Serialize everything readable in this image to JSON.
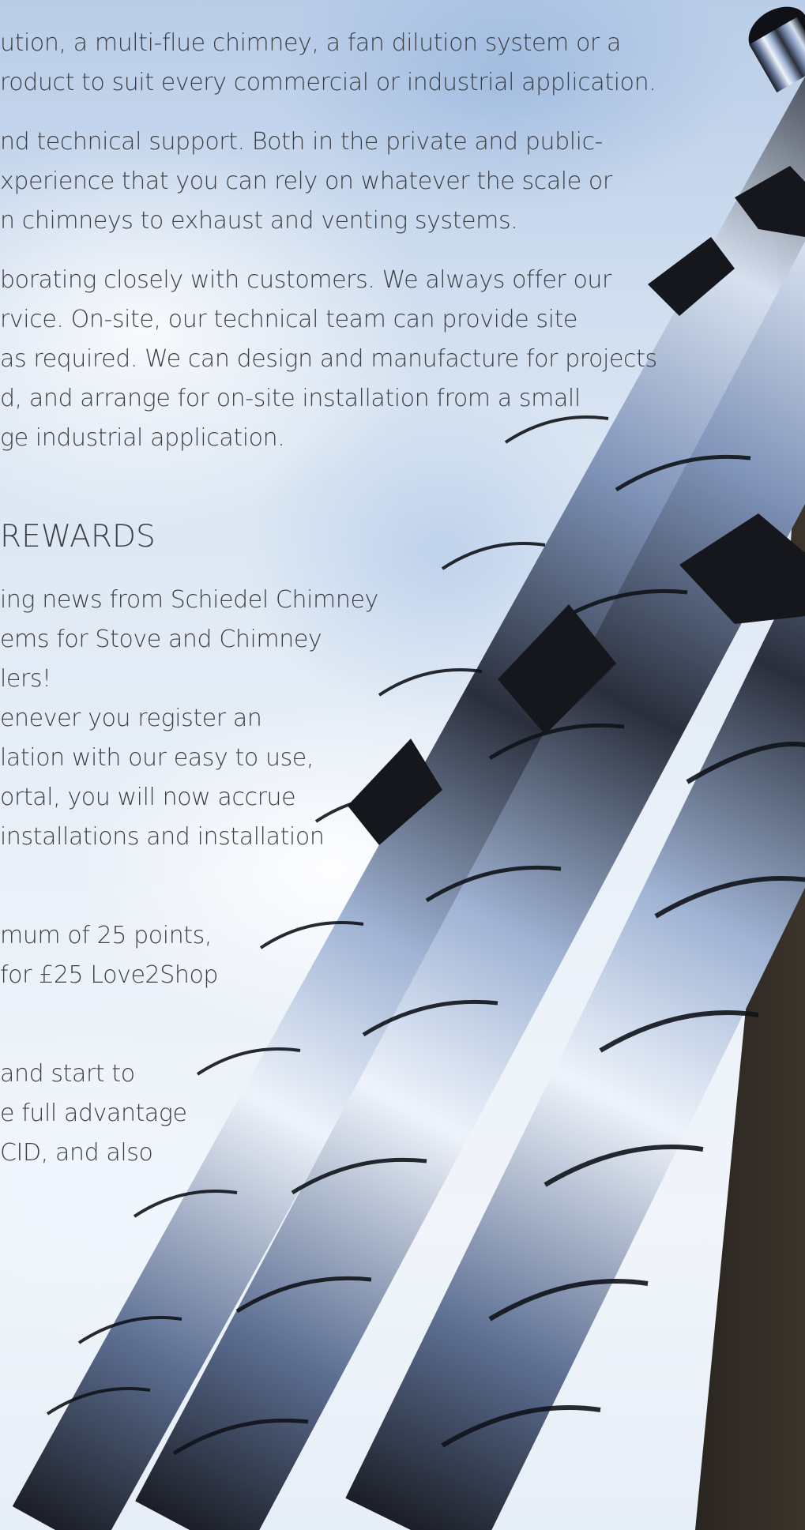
{
  "intro_lines": [
    "ution, a multi-flue chimney, a fan dilution system or a",
    "roduct to suit every commercial or industrial application.",
    "nd technical support. Both in the private and public-",
    "xperience that you can rely on whatever the scale or",
    "n chimneys to exhaust and venting systems.",
    "borating closely with customers. We always offer our",
    "rvice. On-site, our technical team can provide site",
    "as required. We can design and manufacture for projects",
    "d, and arrange for on-site installation from a small",
    "ge industrial application."
  ],
  "heading": "REWARDS",
  "rewards_lines": [
    "ing news from Schiedel Chimney",
    "ems for Stove and Chimney",
    "lers!",
    "enever you register an",
    "lation with our easy to use,",
    "ortal, you will now accrue",
    " installations and installation",
    "mum of 25 points,",
    " for £25 Love2Shop",
    "and start to",
    "e full advantage",
    "CID, and also"
  ],
  "colors": {
    "text": "#3d3f44",
    "sky": "#c9d9ee",
    "steel_dark": "#1b1e26",
    "steel_light": "#eef3fb"
  }
}
